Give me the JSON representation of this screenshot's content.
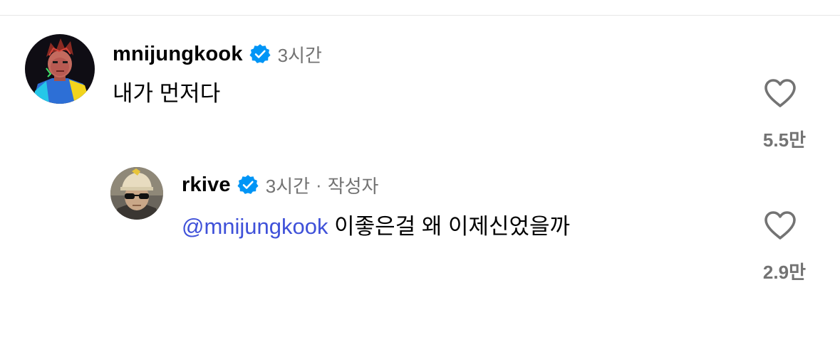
{
  "comments": [
    {
      "username": "mnijungkook",
      "verified": true,
      "time": "3시간",
      "text": "내가 먼저다",
      "like_count": "5.5만",
      "avatar": "cartoon-character-avatar"
    },
    {
      "username": "rkive",
      "verified": true,
      "time": "3시간",
      "separator": "·",
      "author_badge": "작성자",
      "mention": "@mnijungkook",
      "text": " 이좋은걸 왜 이제신었을까",
      "like_count": "2.9만",
      "avatar": "person-photo-avatar"
    }
  ],
  "icons": {
    "verified": "verified-badge-icon",
    "like": "heart-outline-icon"
  },
  "colors": {
    "verified_blue": "#0095f6",
    "mention_blue": "#3f51d9",
    "muted_gray": "#737373",
    "heart_gray": "#737373"
  }
}
